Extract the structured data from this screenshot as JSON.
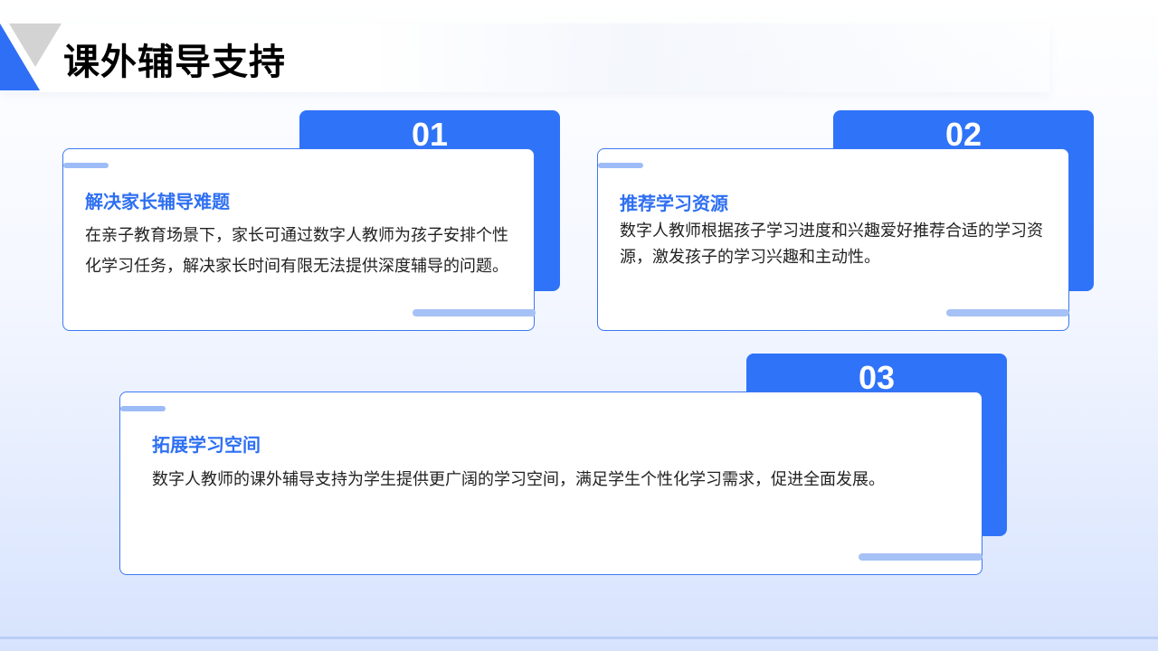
{
  "page": {
    "title": "课外辅导支持"
  },
  "cards": [
    {
      "number": "01",
      "title": "解决家长辅导难题",
      "text": "在亲子教育场景下，家长可通过数字人教师为孩子安排个性化学习任务，解决家长时间有限无法提供深度辅导的问题。"
    },
    {
      "number": "02",
      "title": "推荐学习资源",
      "text": "数字人教师根据孩子学习进度和兴趣爱好推荐合适的学习资源，激发孩子的学习兴趣和主动性。"
    },
    {
      "number": "03",
      "title": "拓展学习空间",
      "text": "数字人教师的课外辅导支持为学生提供更广阔的学习空间，满足学生个性化学习需求，促进全面发展。"
    }
  ],
  "colors": {
    "accent": "#2f73f8",
    "title_blue": "#2e6ff2",
    "border": "#3b78f2"
  }
}
